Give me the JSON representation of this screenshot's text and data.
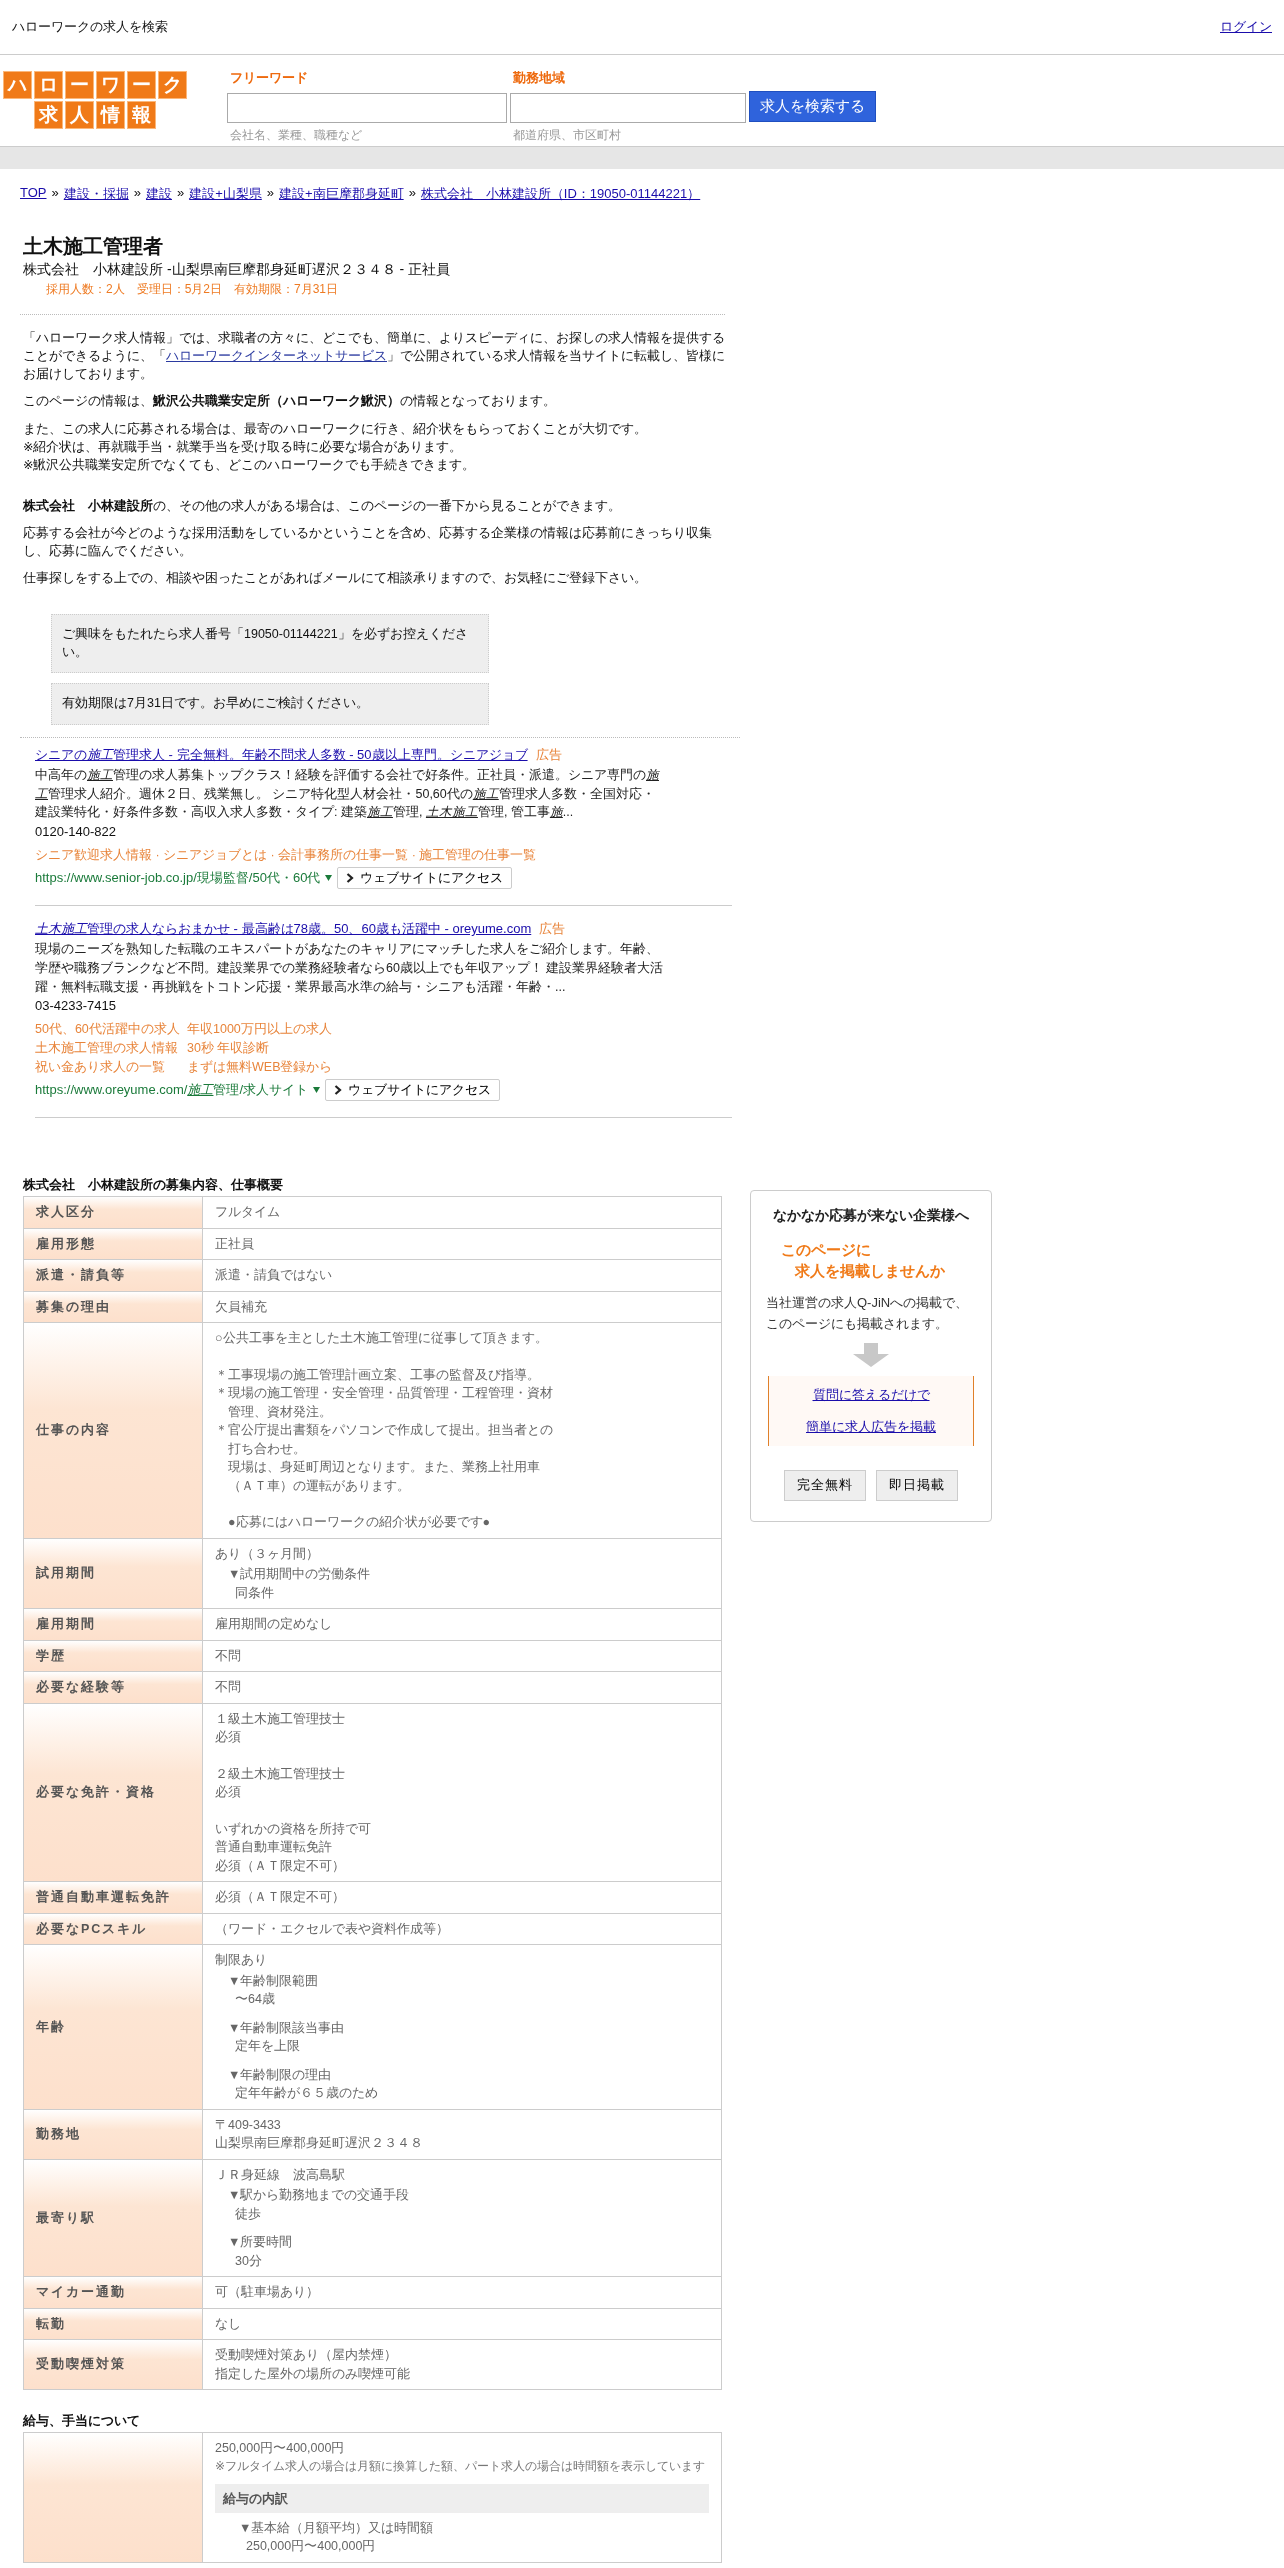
{
  "header": {
    "title": "ハローワークの求人を検索",
    "login": "ログイン"
  },
  "logo": {
    "rows": [
      "ハローワーク",
      "求人情報"
    ]
  },
  "search": {
    "fields": [
      {
        "label": "フリーワード",
        "hint": "会社名、業種、職種など"
      },
      {
        "label": "勤務地域",
        "hint": "都道府県、市区町村"
      }
    ],
    "button": "求人を検索する"
  },
  "breadcrumb_separator": "»",
  "breadcrumb": [
    "TOP",
    "建設・採掘",
    "建設",
    "建設+山梨県",
    "建設+南巨摩郡身延町",
    "株式会社　小林建設所（ID：19050-01144221）"
  ],
  "job": {
    "title": "土木施工管理者",
    "subtitle": "株式会社　小林建設所 -山梨県南巨摩郡身延町遅沢２３４８ - 正社員",
    "meta": "採用人数：2人　受理日：5月2日　有効期限：7月31日"
  },
  "intro": [
    {
      "kind": "link",
      "before": "「ハローワーク求人情報」では、求職者の方々に、どこでも、簡単に、よりスピーディに、お探しの求人情報を提供することができるように、「",
      "link": "ハローワークインターネットサービス",
      "after": "」で公開されている求人情報を当サイトに転載し、皆様にお届けしております。"
    },
    {
      "kind": "text",
      "text": "このページの情報は、**鰍沢公共職業安定所（ハローワーク鰍沢）**の情報となっております。"
    },
    {
      "kind": "text",
      "text": "また、この求人に応募される場合は、最寄のハローワークに行き、紹介状をもらっておくことが大切です。\n※紹介状は、再就職手当・就業手当を受け取る時に必要な場合があります。\n※鰍沢公共職業安定所でなくても、どこのハローワークでも手続きできます。"
    }
  ],
  "company_note": [
    "**株式会社　小林建設所**の、その他の求人がある場合は、このページの一番下から見ることができます。",
    "応募する会社が今どのような採用活動をしているかということを含め、応募する企業様の情報は応募前にきっちり収集し、応募に臨んでください。",
    "仕事探しをする上での、相談や困ったことがあればメールにて相談承りますので、お気軽にご登録下さい。"
  ],
  "notices": [
    "ご興味をもたれたら求人番号「19050-01144221」を必ずお控えください。",
    "有効期限は7月31日です。お早めにご検討ください。"
  ],
  "ads": [
    {
      "title": [
        {
          "text": "シニアの",
          "italic": false
        },
        {
          "text": "施工",
          "italic": true
        },
        {
          "text": "管理求人 - 完全無料。年齢不問求人多数 - 50歳以上専門。シニアジョブ",
          "italic": false
        }
      ],
      "label": "広告",
      "description": [
        {
          "text": "中高年の",
          "italic": false
        },
        {
          "text": "施工",
          "italic": true
        },
        {
          "text": "管理の求人募集トップクラス！経験を評価する会社で好条件。正社員・派遣。シニア専門の",
          "italic": false
        },
        {
          "text": "施工",
          "italic": true
        },
        {
          "text": "管理求人紹介。週休２日、残業無し。 シニア特化型人材会社・50,60代の",
          "italic": false
        },
        {
          "text": "施工",
          "italic": true
        },
        {
          "text": "管理求人多数・全国対応・建設業特化・好条件多数・高収入求人多数・タイプ: 建築",
          "italic": false
        },
        {
          "text": "施工",
          "italic": true
        },
        {
          "text": "管理, ",
          "italic": false
        },
        {
          "text": "土木施工",
          "italic": true
        },
        {
          "text": "管理, 管工事",
          "italic": false
        },
        {
          "text": "施",
          "italic": true
        },
        {
          "text": "...",
          "italic": false
        }
      ],
      "phone": "0120-140-822",
      "sitelink_line": "シニア歓迎求人情報 · シニアジョブとは · 会計事務所の仕事一覧 · 施工管理の仕事一覧",
      "url": [
        {
          "text": "https://www.senior-job.co.jp/現場監督/50代・60代",
          "italic": false
        }
      ],
      "button": "ウェブサイトにアクセス"
    },
    {
      "title": [
        {
          "text": "土木施工",
          "italic": true
        },
        {
          "text": "管理の求人ならおまかせ - 最高齢は78歳。50、60歳も活躍中 - oreyume.com",
          "italic": false
        }
      ],
      "label": "広告",
      "description": [
        {
          "text": "現場のニーズを熟知した転職のエキスパートがあなたのキャリアにマッチした求人をご紹介します。年齢、学歴や職務ブランクなど不問。建設業界での業務経験者なら60歳以上でも年収アップ！ 建設業界経験者大活躍・無料転職支援・再挑戦をトコトン応援・業界最高水準の給与・シニアも活躍・年齢・...",
          "italic": false
        }
      ],
      "phone": "03-4233-7415",
      "sitelinks": [
        [
          "50代、60代活躍中の求人",
          "年収1000万円以上の求人"
        ],
        [
          "土木施工管理の求人情報",
          "30秒 年収診断"
        ],
        [
          "祝い金あり求人の一覧",
          "まずは無料WEB登録から"
        ]
      ],
      "url": [
        {
          "text": "https://www.oreyume.com/",
          "italic": false
        },
        {
          "text": "施工",
          "italic": true
        },
        {
          "text": "管理/求人サイト",
          "italic": false
        }
      ],
      "button": "ウェブサイトにアクセス"
    }
  ],
  "details": {
    "heading": "株式会社　小林建設所の募集内容、仕事概要",
    "rows": [
      {
        "label": "求人区分",
        "value": [
          {
            "kind": "plain",
            "lines": [
              "フルタイム"
            ]
          }
        ]
      },
      {
        "label": "雇用形態",
        "value": [
          {
            "kind": "plain",
            "lines": [
              "正社員"
            ]
          }
        ]
      },
      {
        "label": "派遣・請負等",
        "value": [
          {
            "kind": "plain",
            "lines": [
              "派遣・請負ではない"
            ]
          }
        ]
      },
      {
        "label": "募集の理由",
        "value": [
          {
            "kind": "plain",
            "lines": [
              "欠員補充"
            ]
          }
        ]
      },
      {
        "label": "仕事の内容",
        "value": [
          {
            "kind": "plain",
            "lines": [
              "○公共工事を主とした土木施工管理に従事して頂きます。"
            ]
          },
          {
            "kind": "plain",
            "lines": [
              "＊工事現場の施工管理計画立案、工事の監督及び指導。",
              "＊現場の施工管理・安全管理・品質管理・工程管理・資材",
              "　管理、資材発注。",
              "＊官公庁提出書類をパソコンで作成して提出。担当者との",
              "　打ち合わせ。",
              "　現場は、身延町周辺となります。また、業務上社用車",
              "　（ＡＴ車）の運転があります。"
            ]
          },
          {
            "kind": "plain",
            "lines": [
              "　●応募にはハローワークの紹介状が必要です●"
            ]
          }
        ]
      },
      {
        "label": "試用期間",
        "value": [
          {
            "kind": "plain",
            "lines": [
              "あり（３ヶ月間）"
            ]
          },
          {
            "kind": "sub",
            "lines": [
              "▼試用期間中の労働条件",
              "同条件"
            ]
          }
        ]
      },
      {
        "label": "雇用期間",
        "value": [
          {
            "kind": "plain",
            "lines": [
              "雇用期間の定めなし"
            ]
          }
        ]
      },
      {
        "label": "学歴",
        "value": [
          {
            "kind": "plain",
            "lines": [
              "不問"
            ]
          }
        ]
      },
      {
        "label": "必要な経験等",
        "value": [
          {
            "kind": "plain",
            "lines": [
              "不問"
            ]
          }
        ]
      },
      {
        "label": "必要な免許・資格",
        "value": [
          {
            "kind": "plain",
            "lines": [
              "１級土木施工管理技士",
              "必須"
            ]
          },
          {
            "kind": "plain",
            "lines": [
              "２級土木施工管理技士",
              "必須"
            ]
          },
          {
            "kind": "plain",
            "lines": [
              "いずれかの資格を所持で可",
              "普通自動車運転免許",
              "必須（ＡＴ限定不可）"
            ]
          }
        ]
      },
      {
        "label": "普通自動車運転免許",
        "value": [
          {
            "kind": "plain",
            "lines": [
              "必須（ＡＴ限定不可）"
            ]
          }
        ]
      },
      {
        "label": "必要なPCスキル",
        "value": [
          {
            "kind": "plain",
            "lines": [
              "（ワード・エクセルで表や資料作成等）"
            ]
          }
        ]
      },
      {
        "label": "年齢",
        "value": [
          {
            "kind": "plain",
            "lines": [
              "制限あり"
            ]
          },
          {
            "kind": "sub",
            "lines": [
              "▼年齢制限範囲",
              "〜64歳"
            ]
          },
          {
            "kind": "sub",
            "lines": [
              "▼年齢制限該当事由",
              "定年を上限"
            ]
          },
          {
            "kind": "sub",
            "lines": [
              "▼年齢制限の理由",
              "定年年齢が６５歳のため"
            ]
          }
        ]
      },
      {
        "label": "勤務地",
        "value": [
          {
            "kind": "plain",
            "lines": [
              "〒409-3433",
              "山梨県南巨摩郡身延町遅沢２３４８"
            ]
          }
        ]
      },
      {
        "label": "最寄り駅",
        "value": [
          {
            "kind": "plain",
            "lines": [
              "ＪＲ身延線　波高島駅"
            ]
          },
          {
            "kind": "sub",
            "lines": [
              "▼駅から勤務地までの交通手段",
              "徒歩"
            ]
          },
          {
            "kind": "sub",
            "lines": [
              "▼所要時間",
              "30分"
            ]
          }
        ]
      },
      {
        "label": "マイカー通勤",
        "value": [
          {
            "kind": "plain",
            "lines": [
              "可（駐車場あり）"
            ]
          }
        ]
      },
      {
        "label": "転勤",
        "value": [
          {
            "kind": "plain",
            "lines": [
              "なし"
            ]
          }
        ]
      },
      {
        "label": "受動喫煙対策",
        "value": [
          {
            "kind": "plain",
            "lines": [
              "受動喫煙対策あり（屋内禁煙）",
              "指定した屋外の場所のみ喫煙可能"
            ]
          }
        ]
      }
    ]
  },
  "salary": {
    "heading": "給与、手当について",
    "amount": "250,000円〜400,000円",
    "note": "※フルタイム求人の場合は月額に換算した額、パート求人の場合は時間額を表示しています",
    "breakdown_title": "給与の内訳",
    "breakdown": {
      "heading": "▼基本給（月額平均）又は時間額",
      "value": "250,000円〜400,000円"
    }
  },
  "sidebar": {
    "title": "なかなか応募が来ない企業様へ",
    "catch": [
      "このページに",
      "求人を掲載しませんか"
    ],
    "text": "当社運営の求人Q-JiNへの掲載で、このページにも掲載されます。",
    "links": [
      "質問に答えるだけで",
      "簡単に求人広告を掲載"
    ],
    "buttons": [
      "完全無料",
      "即日掲載"
    ]
  }
}
